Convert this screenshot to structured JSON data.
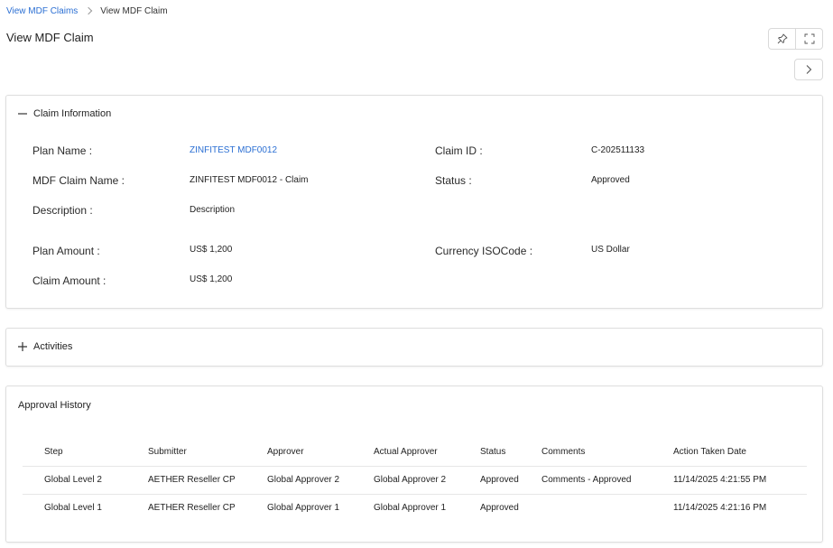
{
  "breadcrumb": {
    "parent": "View MDF Claims",
    "current": "View MDF Claim"
  },
  "page": {
    "title": "View MDF Claim"
  },
  "claim_info": {
    "section_title": "Claim Information",
    "plan_name_label": "Plan Name :",
    "plan_name_value": "ZINFITEST MDF0012",
    "claim_id_label": "Claim ID :",
    "claim_id_value": "C-202511133",
    "mdf_claim_name_label": "MDF Claim Name :",
    "mdf_claim_name_value": "ZINFITEST MDF0012 - Claim",
    "status_label": "Status :",
    "status_value": "Approved",
    "description_label": "Description :",
    "description_value": "Description",
    "plan_amount_label": "Plan Amount :",
    "plan_amount_value": "US$ 1,200",
    "currency_label": "Currency ISOCode :",
    "currency_value": "US Dollar",
    "claim_amount_label": "Claim Amount :",
    "claim_amount_value": "US$ 1,200"
  },
  "activities": {
    "section_title": "Activities"
  },
  "approval_history": {
    "title": "Approval History",
    "columns": [
      "Step",
      "Submitter",
      "Approver",
      "Actual Approver",
      "Status",
      "Comments",
      "Action Taken Date"
    ],
    "rows": [
      [
        "Global Level 2",
        "AETHER Reseller CP",
        "Global Approver 2",
        "Global Approver 2",
        "Approved",
        "Comments - Approved",
        "11/14/2025 4:21:55 PM"
      ],
      [
        "Global Level 1",
        "AETHER Reseller CP",
        "Global Approver 1",
        "Global Approver 1",
        "Approved",
        "",
        "11/14/2025 4:21:16 PM"
      ]
    ]
  },
  "icons": {
    "pin": "pin-icon",
    "expand": "fullscreen-icon",
    "next": "chevron-right-icon",
    "collapse": "minus-icon",
    "expand_section": "plus-icon"
  },
  "colors": {
    "link": "#2b6fd3",
    "border": "#dedede"
  }
}
